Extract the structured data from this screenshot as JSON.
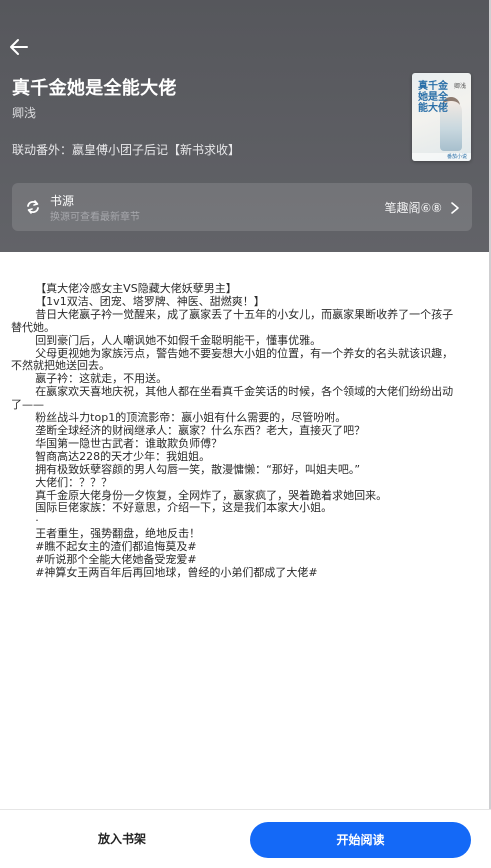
{
  "book": {
    "title": "真千金她是全能大佬",
    "author": "卿浅",
    "extra_line": "联动番外：嬴皇傅小团子后记【新书求收】",
    "cover": {
      "title_text": "真千金她是全能大佬",
      "author_text": "卿浅",
      "publisher_text": "番茄小说"
    }
  },
  "source": {
    "title": "书源",
    "subtitle": "换源可查看最新章节",
    "current": "笔趣阁⑥⑧"
  },
  "intro": [
    "【真大佬冷感女主VS隐藏大佬妖孽男主】",
    "【1v1双洁、团宠、塔罗牌、神医、甜燃爽！】",
    "昔日大佬嬴子衿一觉醒来，成了嬴家丢了十五年的小女儿，而嬴家果断收养了一个孩子替代她。",
    "回到豪门后，人人嘲讽她不如假千金聪明能干，懂事优雅。",
    "父母更视她为家族污点，警告她不要妄想大小姐的位置，有一个养女的名头就该识趣，不然就把她送回去。",
    "嬴子衿：这就走，不用送。",
    "在嬴家欢天喜地庆祝，其他人都在坐看真千金笑话的时候，各个领域的大佬们纷纷出动了——",
    "粉丝战斗力top1的顶流影帝：嬴小姐有什么需要的，尽管吩咐。",
    "垄断全球经济的财阀继承人：嬴家？什么东西？老大，直接灭了吧？",
    "华国第一隐世古武者：谁敢欺负师傅？",
    "智商高达228的天才少年：我姐姐。",
    "拥有极致妖孽容颜的男人勾唇一笑，散漫慵懒：“那好，叫姐夫吧。”",
    "大佬们：？？？",
    "真千金原大佬身份一夕恢复，全网炸了，嬴家疯了，哭着跪着求她回来。",
    "国际巨佬家族：不好意思，介绍一下，这是我们本家大小姐。",
    "·",
    "王者重生，强势翻盘，绝地反击！",
    "#瞧不起女主的渣们都追悔莫及#",
    "#听说那个全能大佬她备受宠爱#",
    "#神算女王两百年后再回地球，曾经的小弟们都成了大佬#"
  ],
  "actions": {
    "add_shelf": "放入书架",
    "start_reading": "开始阅读"
  },
  "colors": {
    "header_bg": "#5d5e63",
    "accent": "#1469f7"
  },
  "icons": [
    "back-arrow-icon",
    "refresh-source-icon",
    "chevron-right-icon"
  ]
}
